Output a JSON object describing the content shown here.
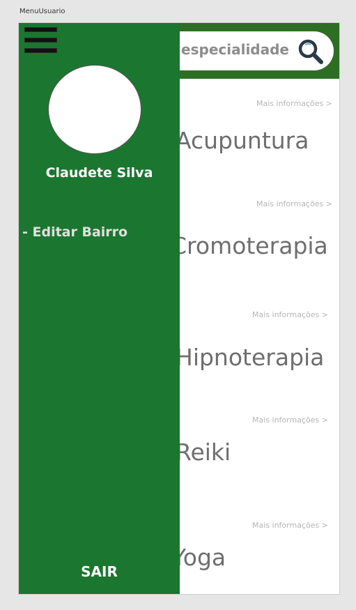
{
  "frame": {
    "label": "MenuUsuario"
  },
  "search": {
    "placeholder": "a especialidade",
    "icon": "search-icon"
  },
  "specialties": [
    {
      "more": "Mais informações >",
      "name": "Acupuntura"
    },
    {
      "more": "Mais informações >",
      "name": "Cromoterapia"
    },
    {
      "more": "Mais informações >",
      "name": "Hipnoterapia"
    },
    {
      "more": "Mais informações >",
      "name": "Reiki"
    },
    {
      "more": "Mais informações >",
      "name": "Yoga"
    }
  ],
  "drawer": {
    "menu_icon": "hamburger-menu-icon",
    "user_name": "Claudete Silva",
    "items": [
      {
        "label": "- Editar Bairro"
      }
    ],
    "logout_label": "SAIR"
  },
  "colors": {
    "drawer_bg": "#1b7630",
    "topbar_bg": "#2d6e24",
    "canvas_bg": "#e6e6e6"
  }
}
